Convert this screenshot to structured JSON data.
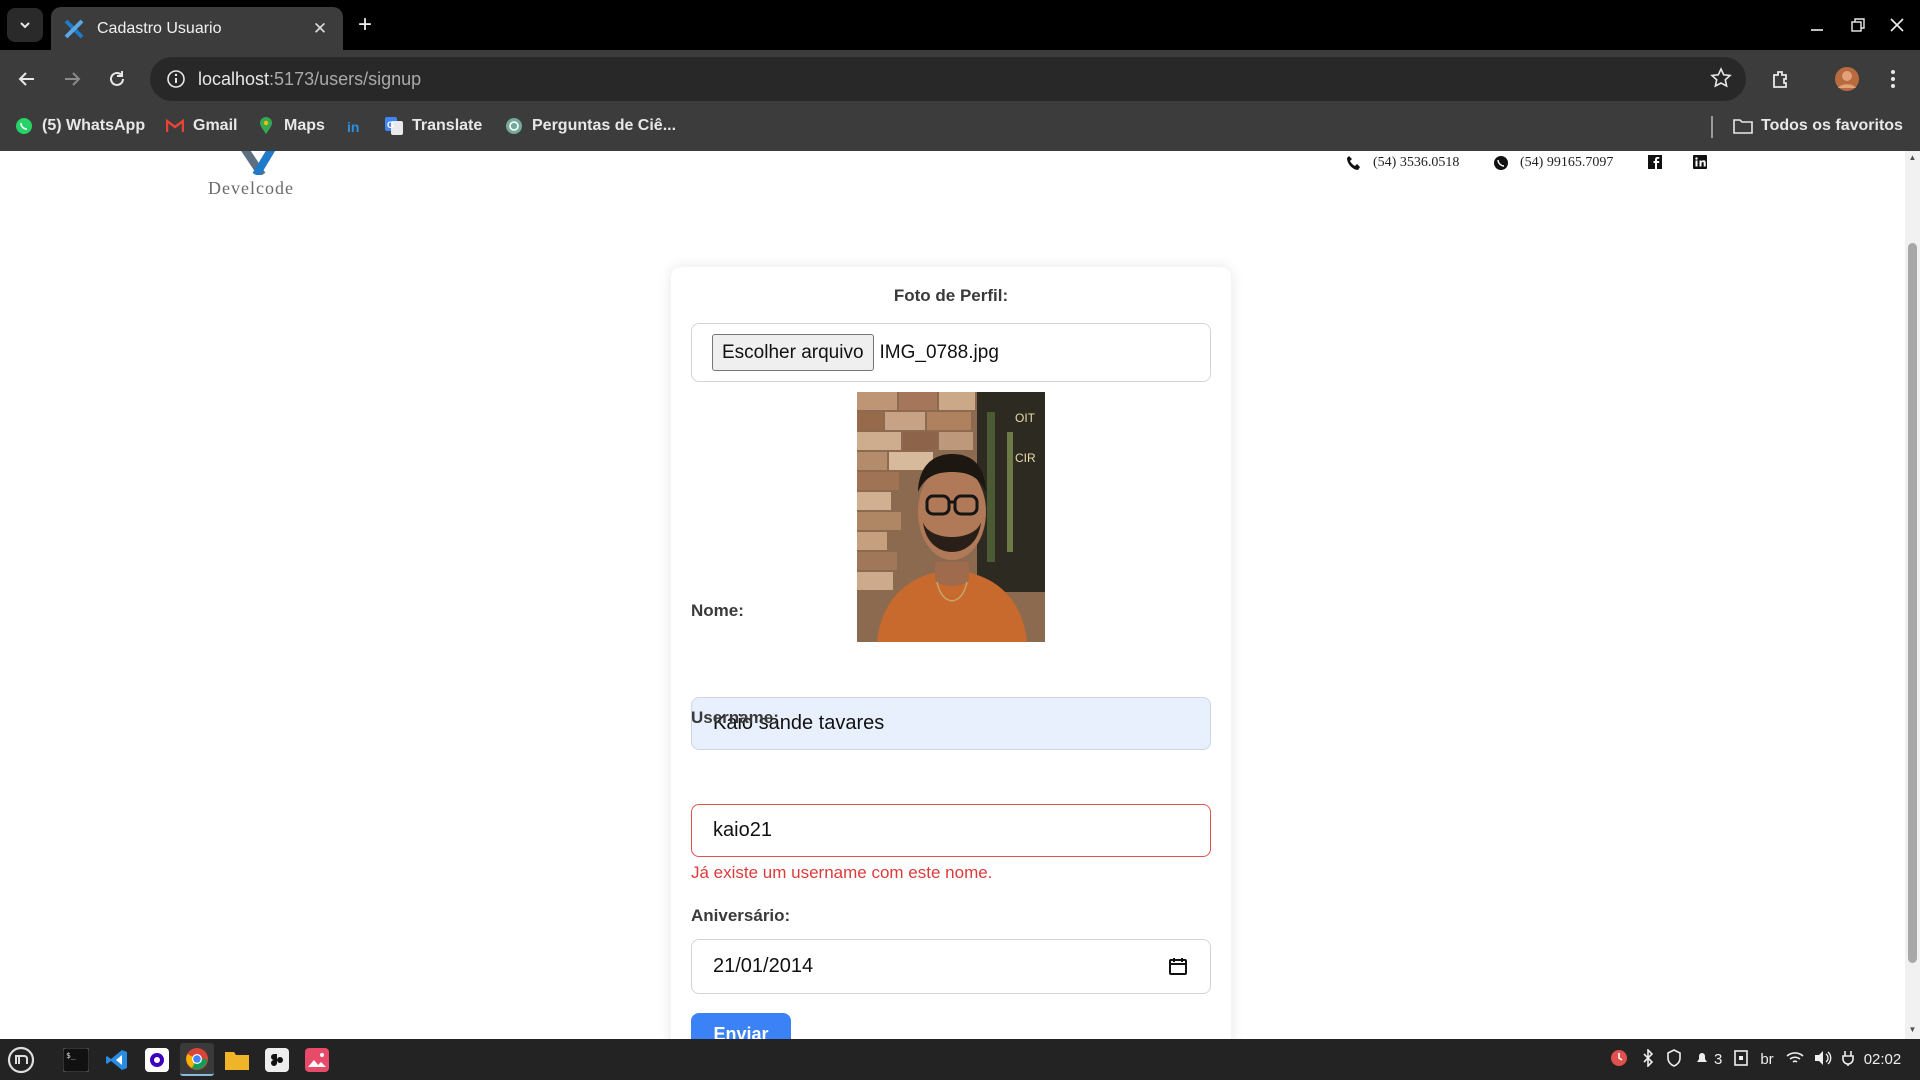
{
  "browser": {
    "tab_title": "Cadastro Usuario",
    "new_tab": "+",
    "url_host": "localhost",
    "url_rest": ":5173/users/signup",
    "window_controls": {
      "minimize": "minimize-icon",
      "restore": "restore-icon",
      "close": "close-icon"
    }
  },
  "bookmarks": [
    {
      "label": "(5) WhatsApp",
      "icon": "whatsapp-icon"
    },
    {
      "label": "Gmail",
      "icon": "gmail-icon"
    },
    {
      "label": "Maps",
      "icon": "maps-icon"
    },
    {
      "label": "",
      "icon": "linkedin-icon"
    },
    {
      "label": "Translate",
      "icon": "translate-icon"
    },
    {
      "label": "Perguntas de Ciê...",
      "icon": "chatgpt-icon"
    }
  ],
  "bookmarks_all": "Todos os favoritos",
  "header": {
    "logo_text": "Develcode",
    "phone": "(54) 3536.0518",
    "whatsapp": "(54) 99165.7097"
  },
  "form": {
    "photo_label": "Foto de Perfil:",
    "file_button": "Escolher arquivo",
    "file_name": "IMG_0788.jpg",
    "name_label": "Nome:",
    "name_value": "Kaio sande tavares",
    "username_label": "Username:",
    "username_value": "kaio21",
    "username_error": "Já existe um username com este nome.",
    "birthday_label": "Aniversário:",
    "birthday_value": "21/01/2014",
    "submit_label": "Enviar"
  },
  "taskbar": {
    "keyboard_layout": "br",
    "clock": "02:02",
    "workspace": "3"
  },
  "colors": {
    "accent": "#3b82f6",
    "error": "#dc3b3b",
    "autofill_bg": "#e8f0fe",
    "brand_blue": "#1f7ac9"
  }
}
